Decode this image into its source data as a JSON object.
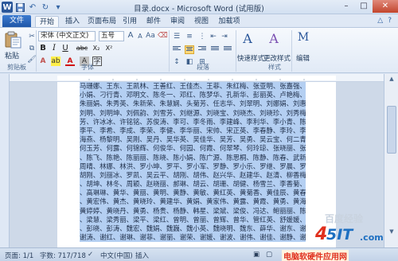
{
  "window": {
    "title": "目录.docx - Microsoft Word (试用版)",
    "app_letter": "W"
  },
  "tabs": [
    {
      "label": "文件"
    },
    {
      "label": "开始"
    },
    {
      "label": "插入"
    },
    {
      "label": "页面布局"
    },
    {
      "label": "引用"
    },
    {
      "label": "邮件"
    },
    {
      "label": "审阅"
    },
    {
      "label": "视图"
    },
    {
      "label": "加载项"
    }
  ],
  "ribbon": {
    "paste_label": "粘贴",
    "clipboard_group": "剪贴板",
    "font_name": "宋体 (中文正文)",
    "font_size": "五号",
    "font_group": "字体",
    "paragraph_group": "段落",
    "quick_style_label": "快速样式",
    "change_style_label": "更改样式",
    "styles_group": "样式",
    "edit_label": "编辑",
    "bold": "B",
    "italic": "I",
    "underline": "U",
    "strike": "abc",
    "sub": "X₂",
    "sup": "X²",
    "style_icon_1": "A",
    "style_icon_2": "A",
    "edit_icon": "M"
  },
  "document": {
    "lines": [
      "马珊娜、王东、王凯林、王善红、王佳杰、王菲、朱红梅、张亚明、张嘉强、邓小娜、郑",
      "小娟、刁行青、邓明文、陈冬一、邓红、陈梦华、孔新华、彭丽英、卢艳梅、卢雪春、白明、",
      "朱丽娟、朱秀英、朱新荣、朱慧娴、头菊芳、任志华、刘翠明、刘娜娟、刘惠群、刘建军、",
      "刘明、刘明坤、刘佩韵、刘雪芳、刘继源、刘晓宝、刘晓杰、刘晓珍、刘秀梅、刘国辉、刘",
      "芳、许冰冰、许铭铭、苏俊涛、李可、李冬雨、李建峰、李利华、李小青、陈明亮、李宏、",
      "李平、李希、李成、李荣、李健、李华丽、宋帅、宋正英、李春静、李玲、李敏、杨海、杨",
      "海燕、杨黎明、吴刚、吴丹、吴华英、吴佳华、吴芳、吴勇、吴云宝、何二青、何小骏、",
      "何玉芳、何露、何锦辉、何俊华、何园、何霞、何翠琴、何玲琼、张晓丽、张雪梅、张红",
      "、陈飞、陈艳、陈丽丽、陈晓、陈小娟、陈广源、陈思桐、陈静、陈春、武新、苗春、",
      "周晴、林娜、林洪、罗小坤、罗平、罗小军、罗静、罗小乐、罗继、罗晨、罗浩、罗华、",
      "胡刚、刘丽冰、罗凯、吴云平、胡刚、胡伟、赵兴华、赵建华、赵清、柳香梅、胡海、胡杰",
      "、胡坤、林冬、周颖、赵晓丽、郝琳、胡云、胡珊、胡健、杨雪兰、李香菊、王伟、江晓兰",
      "、高琳琳、黄华、黄丽、黄明、黄静、黄敏、黄红英、黄菊香、黄佳辰、黄春芳、黄晓华",
      "、黄宏伟、黄杰、黄晓玲、黄建华、黄娟、黄家伟、黄露、黄霞、黄勇、黄海涛、黄晓强、",
      "黄婷婷、黄晓丹、黄勇、杨贵、杨静、韩星、梁斌、梁俊、冯达、鲍丽丽、陈晶晶、梁洁",
      "、梁慧、梁秀丽、梁平、梁红、曾明、曾丽、曾辉、曾华、管红英、舒媛媛、潘颖、彭芳",
      "、彭晓、彭涛、魏宏、魏娟、魏巍、魏小英、魏晓明、魏东、薛华、谢东、谢敏、谢燕、",
      "谢涛、谢红、谢琳、谢菲、谢丽、谢荣、谢媛、谢波、谢伟、谢佳、谢静、谢宏、谢芳、"
    ]
  },
  "status": {
    "page": "页面: 1/1",
    "words": "字数: 717/718",
    "language": "中文(中国)",
    "mode": "插入"
  },
  "watermark": {
    "baidu": "百度经验",
    "site": "4",
    "site2": "5IT",
    "dotcom": ".com",
    "tagline": "电脑软硬件应用网"
  },
  "colors": {
    "file_tab": "#2b579a",
    "selection": "#b4cff2",
    "watermark_red": "#e0301e",
    "watermark_blue": "#1d6fc1"
  }
}
